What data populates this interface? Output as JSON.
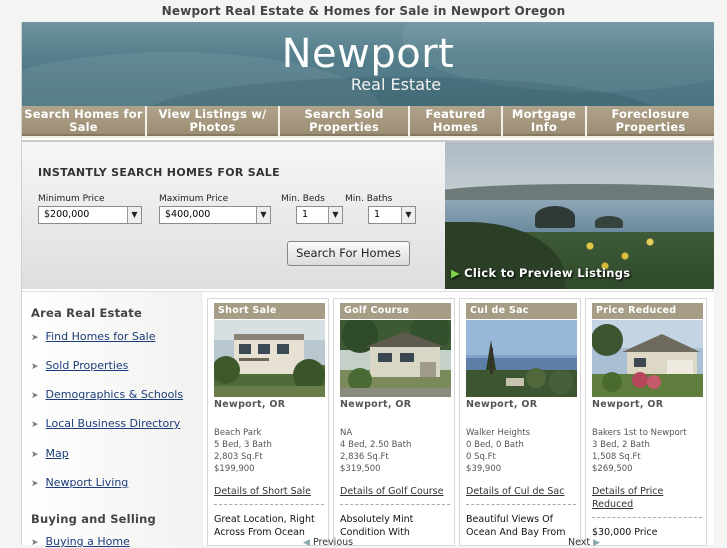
{
  "window": {
    "title": "Newport Real Estate & Homes for Sale in Newport Oregon"
  },
  "header": {
    "brand_name": "Newport",
    "brand_sub": "Real Estate"
  },
  "nav": {
    "items": [
      {
        "line1": "Search Homes for",
        "line2": "Sale"
      },
      {
        "line1": "View Listings w/",
        "line2": "Photos"
      },
      {
        "line1": "Search Sold",
        "line2": "Properties"
      },
      {
        "line1": "Featured",
        "line2": "Homes"
      },
      {
        "line1": "Mortgage",
        "line2": "Info"
      },
      {
        "line1": "Foreclosure",
        "line2": "Properties"
      }
    ]
  },
  "search": {
    "heading": "INSTANTLY SEARCH HOMES FOR SALE",
    "min_price_label": "Minimum Price",
    "min_price_value": "$200,000",
    "max_price_label": "Maximum Price",
    "max_price_value": "$400,000",
    "min_beds_label": "Min. Beds",
    "min_beds_value": "1",
    "min_baths_label": "Min. Baths",
    "min_baths_value": "1",
    "button_label": "Search For Homes"
  },
  "preview": {
    "caption": "Click to Preview Listings"
  },
  "sidebar": {
    "area_heading": "Area Real Estate",
    "area_links": [
      "Find Homes for Sale",
      "Sold Properties",
      "Demographics & Schools",
      "Local Business Directory",
      "Map",
      "Newport Living"
    ],
    "buying_heading": "Buying and Selling",
    "buying_links": [
      "Buying a Home"
    ]
  },
  "listings": [
    {
      "tag": "Short Sale",
      "city": "Newport, OR",
      "area": "Beach Park",
      "beds_baths": "5 Bed, 3 Bath",
      "sqft": "2,803 Sq.Ft",
      "price": "$199,900",
      "details_line1": "Details of Short Sale",
      "details_line2": "",
      "blurb_line1": "Great Location, Right",
      "blurb_line2": "Across From Ocean"
    },
    {
      "tag": "Golf Course",
      "city": "Newport, OR",
      "area": "NA",
      "beds_baths": "4 Bed, 2.50 Bath",
      "sqft": "2,836 Sq.Ft",
      "price": "$319,500",
      "details_line1": "Details of Golf Course",
      "details_line2": "",
      "blurb_line1": "Absolutely Mint",
      "blurb_line2": "Condition With"
    },
    {
      "tag": "Cul de Sac",
      "city": "Newport, OR",
      "area": "Walker Heights",
      "beds_baths": "0 Bed, 0 Bath",
      "sqft": "0 Sq.Ft",
      "price": "$39,900",
      "details_line1": "Details of Cul de Sac",
      "details_line2": "",
      "blurb_line1": "Beautiful Views Of",
      "blurb_line2": "Ocean And Bay From"
    },
    {
      "tag": "Price Reduced",
      "city": "Newport, OR",
      "area": "Bakers 1st to Newport",
      "beds_baths": "3 Bed, 2 Bath",
      "sqft": "1,508 Sq.Ft",
      "price": "$269,500",
      "details_line1": "Details of Price",
      "details_line2": "Reduced",
      "blurb_line1": "$30,000 Price",
      "blurb_line2": ""
    }
  ],
  "pager": {
    "previous": "Previous",
    "next": "Next"
  },
  "colors": {
    "banner": "#557f8c",
    "nav": "#a3957b",
    "tag": "#a79d86",
    "link": "#1c3d7a"
  }
}
